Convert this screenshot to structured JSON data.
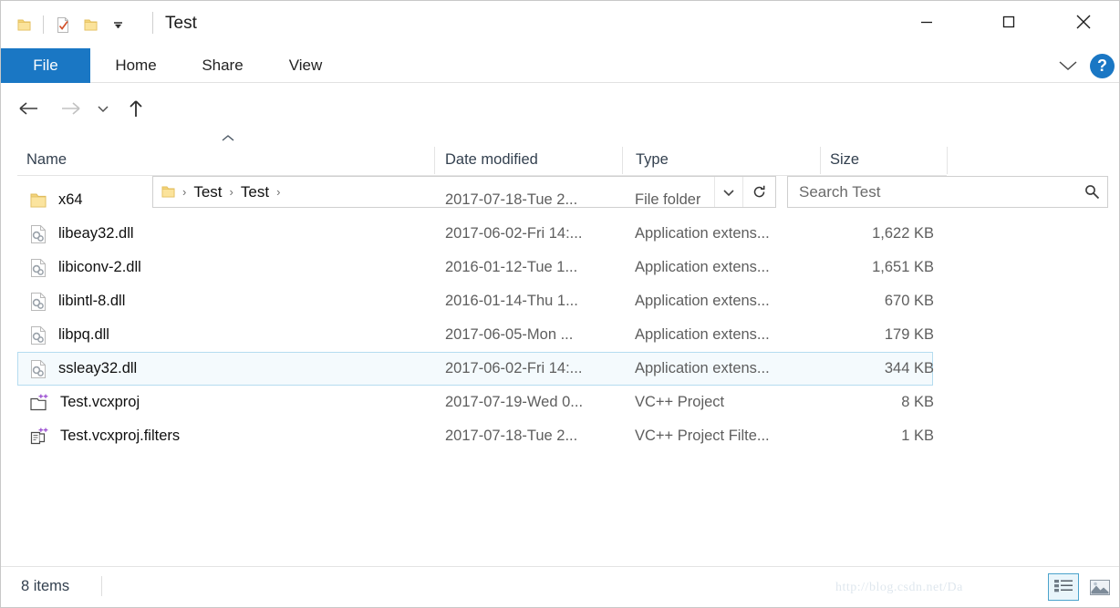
{
  "window": {
    "title": "Test",
    "quick_access": [
      {
        "name": "folder-icon",
        "label": "Explorer"
      },
      {
        "name": "properties-icon",
        "label": "Properties"
      },
      {
        "name": "new-folder-icon",
        "label": "New folder"
      },
      {
        "name": "customize-qat-icon",
        "label": "Customize Quick Access Toolbar"
      }
    ],
    "controls": {
      "minimize": "Minimize",
      "maximize": "Maximize",
      "close": "Close"
    }
  },
  "ribbon": {
    "tabs": [
      {
        "label": "File",
        "active": true
      },
      {
        "label": "Home",
        "active": false
      },
      {
        "label": "Share",
        "active": false
      },
      {
        "label": "View",
        "active": false
      }
    ],
    "expand_label": "Expand the Ribbon",
    "help_label": "?",
    "accent_color": "#1a77c4"
  },
  "navigation": {
    "back": "Back",
    "forward": "Forward",
    "recent": "Recent locations",
    "up": "Up",
    "breadcrumbs": [
      "Test",
      "Test"
    ],
    "separator": "›",
    "dropdown": "Previous locations",
    "refresh": "Refresh"
  },
  "search": {
    "placeholder": "Search Test",
    "value": ""
  },
  "columns": [
    {
      "key": "name",
      "label": "Name",
      "sorted": "asc"
    },
    {
      "key": "date",
      "label": "Date modified",
      "sorted": ""
    },
    {
      "key": "type",
      "label": "Type",
      "sorted": ""
    },
    {
      "key": "size",
      "label": "Size",
      "sorted": ""
    }
  ],
  "files": [
    {
      "name": "x64",
      "date": "2017-07-18-Tue 2...",
      "type": "File folder",
      "size": "",
      "icon": "folder-icon",
      "selected": false
    },
    {
      "name": "libeay32.dll",
      "date": "2017-06-02-Fri 14:...",
      "type": "Application extens...",
      "size": "1,622 KB",
      "icon": "dll-icon",
      "selected": false
    },
    {
      "name": "libiconv-2.dll",
      "date": "2016-01-12-Tue 1...",
      "type": "Application extens...",
      "size": "1,651 KB",
      "icon": "dll-icon",
      "selected": false
    },
    {
      "name": "libintl-8.dll",
      "date": "2016-01-14-Thu 1...",
      "type": "Application extens...",
      "size": "670 KB",
      "icon": "dll-icon",
      "selected": false
    },
    {
      "name": "libpq.dll",
      "date": "2017-06-05-Mon ...",
      "type": "Application extens...",
      "size": "179 KB",
      "icon": "dll-icon",
      "selected": false
    },
    {
      "name": "ssleay32.dll",
      "date": "2017-06-02-Fri 14:...",
      "type": "Application extens...",
      "size": "344 KB",
      "icon": "dll-icon",
      "selected": true
    },
    {
      "name": "Test.vcxproj",
      "date": "2017-07-19-Wed 0...",
      "type": "VC++ Project",
      "size": "8 KB",
      "icon": "vcxproj-icon",
      "selected": false
    },
    {
      "name": "Test.vcxproj.filters",
      "date": "2017-07-18-Tue 2...",
      "type": "VC++ Project Filte...",
      "size": "1 KB",
      "icon": "vcxproj-filters-icon",
      "selected": false
    }
  ],
  "status": {
    "item_count": "8 items",
    "watermark": "http://blog.csdn.net/Da",
    "view_details": "Details view",
    "view_large_icons": "Large icons view"
  }
}
